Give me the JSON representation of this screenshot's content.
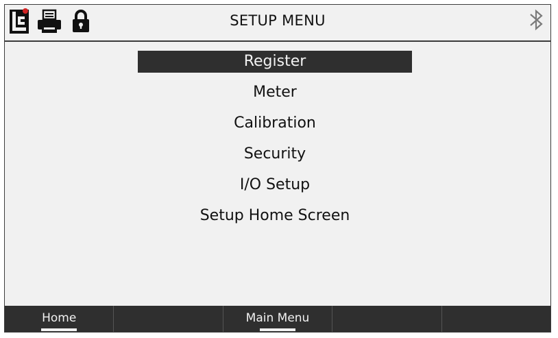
{
  "header": {
    "title": "SETUP MENU",
    "icons": [
      "logo-icon",
      "printer-icon",
      "lock-icon",
      "bluetooth-icon"
    ]
  },
  "menu": {
    "items": [
      {
        "label": "Register",
        "selected": true
      },
      {
        "label": "Meter"
      },
      {
        "label": "Calibration"
      },
      {
        "label": "Security"
      },
      {
        "label": "I/O Setup"
      },
      {
        "label": "Setup Home Screen"
      }
    ]
  },
  "footer": {
    "buttons": [
      {
        "label": "Home",
        "active": true
      },
      {
        "label": ""
      },
      {
        "label": "Main Menu",
        "active": true
      },
      {
        "label": ""
      },
      {
        "label": ""
      }
    ]
  },
  "colors": {
    "background": "#f1f1f1",
    "bar": "#2f2f2f",
    "text": "#111111",
    "accent_red": "#d32424"
  }
}
